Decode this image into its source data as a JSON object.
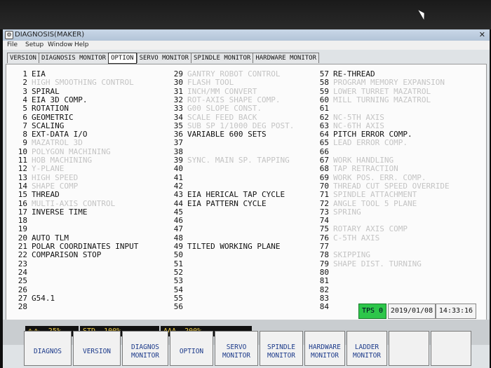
{
  "window": {
    "title": "DIAGNOSIS(MAKER)",
    "close": "✕"
  },
  "menu": [
    "File",
    "Setup",
    "Window",
    "Help"
  ],
  "tabs": [
    {
      "label": "VERSION",
      "active": false
    },
    {
      "label": "DIAGNOSIS MONITOR",
      "active": false
    },
    {
      "label": "OPTION",
      "active": true
    },
    {
      "label": "SERVO MONITOR",
      "active": false
    },
    {
      "label": "SPINDLE MONITOR",
      "active": false
    },
    {
      "label": "HARDWARE MONITOR",
      "active": false
    }
  ],
  "options": {
    "col1": [
      {
        "n": "1",
        "label": "EIA",
        "on": true
      },
      {
        "n": "2",
        "label": "HIGH SMOOTHING CONTROL",
        "on": false
      },
      {
        "n": "3",
        "label": "SPIRAL",
        "on": true
      },
      {
        "n": "4",
        "label": "EIA 3D COMP.",
        "on": true
      },
      {
        "n": "5",
        "label": "ROTATION",
        "on": true
      },
      {
        "n": "6",
        "label": "GEOMETRIC",
        "on": true
      },
      {
        "n": "7",
        "label": "SCALING",
        "on": true
      },
      {
        "n": "8",
        "label": "EXT-DATA I/O",
        "on": true
      },
      {
        "n": "9",
        "label": "MAZATROL 3D",
        "on": false
      },
      {
        "n": "10",
        "label": "POLYGON MACHINING",
        "on": false
      },
      {
        "n": "11",
        "label": "HOB MACHINING",
        "on": false
      },
      {
        "n": "12",
        "label": "Y-PLANE",
        "on": false
      },
      {
        "n": "13",
        "label": "HIGH SPEED",
        "on": false
      },
      {
        "n": "14",
        "label": "SHAPE COMP",
        "on": false
      },
      {
        "n": "15",
        "label": "THREAD",
        "on": true
      },
      {
        "n": "16",
        "label": "MULTI-AXIS CONTROL",
        "on": false
      },
      {
        "n": "17",
        "label": "INVERSE TIME",
        "on": true
      },
      {
        "n": "18",
        "label": "",
        "on": false
      },
      {
        "n": "19",
        "label": "",
        "on": false
      },
      {
        "n": "20",
        "label": "AUTO TLM",
        "on": true
      },
      {
        "n": "21",
        "label": "POLAR COORDINATES INPUT",
        "on": true
      },
      {
        "n": "22",
        "label": "COMPARISON STOP",
        "on": true
      },
      {
        "n": "23",
        "label": "",
        "on": false
      },
      {
        "n": "24",
        "label": "",
        "on": false
      },
      {
        "n": "25",
        "label": "",
        "on": false
      },
      {
        "n": "26",
        "label": "",
        "on": false
      },
      {
        "n": "27",
        "label": "G54.1",
        "on": true
      },
      {
        "n": "28",
        "label": "",
        "on": false
      }
    ],
    "col2": [
      {
        "n": "29",
        "label": "GANTRY ROBOT CONTROL",
        "on": false
      },
      {
        "n": "30",
        "label": "FLASH TOOL",
        "on": false
      },
      {
        "n": "31",
        "label": "INCH/MM CONVERT",
        "on": false
      },
      {
        "n": "32",
        "label": "ROT-AXIS SHAPE COMP.",
        "on": false
      },
      {
        "n": "33",
        "label": "G00 SLOPE CONST.",
        "on": false
      },
      {
        "n": "34",
        "label": "SCALE FEED BACK",
        "on": false
      },
      {
        "n": "35",
        "label": "SUB SP 1/1000 DEG POST.",
        "on": false
      },
      {
        "n": "36",
        "label": "VARIABLE 600 SETS",
        "on": true
      },
      {
        "n": "37",
        "label": "",
        "on": false
      },
      {
        "n": "38",
        "label": "",
        "on": false
      },
      {
        "n": "39",
        "label": "SYNC. MAIN SP. TAPPING",
        "on": false
      },
      {
        "n": "40",
        "label": "",
        "on": false
      },
      {
        "n": "41",
        "label": "",
        "on": false
      },
      {
        "n": "42",
        "label": "",
        "on": false
      },
      {
        "n": "43",
        "label": "EIA HERICAL TAP CYCLE",
        "on": true
      },
      {
        "n": "44",
        "label": "EIA PATTERN CYCLE",
        "on": true
      },
      {
        "n": "45",
        "label": "",
        "on": false
      },
      {
        "n": "46",
        "label": "",
        "on": false
      },
      {
        "n": "47",
        "label": "",
        "on": false
      },
      {
        "n": "48",
        "label": "",
        "on": false
      },
      {
        "n": "49",
        "label": "TILTED WORKING PLANE",
        "on": true
      },
      {
        "n": "50",
        "label": "",
        "on": false
      },
      {
        "n": "51",
        "label": "",
        "on": false
      },
      {
        "n": "52",
        "label": "",
        "on": false
      },
      {
        "n": "53",
        "label": "",
        "on": false
      },
      {
        "n": "54",
        "label": "",
        "on": false
      },
      {
        "n": "55",
        "label": "",
        "on": false
      },
      {
        "n": "56",
        "label": "",
        "on": false
      }
    ],
    "col3": [
      {
        "n": "57",
        "label": "RE-THREAD",
        "on": true
      },
      {
        "n": "58",
        "label": "PROGRAM MEMORY EXPANSION",
        "on": false
      },
      {
        "n": "59",
        "label": "LOWER TURRET MAZATROL",
        "on": false
      },
      {
        "n": "60",
        "label": "MILL TURNING MAZATROL",
        "on": false
      },
      {
        "n": "61",
        "label": "",
        "on": false
      },
      {
        "n": "62",
        "label": "NC-5TH AXIS",
        "on": false
      },
      {
        "n": "63",
        "label": "NC-6TH AXIS",
        "on": false
      },
      {
        "n": "64",
        "label": "PITCH ERROR COMP.",
        "on": true
      },
      {
        "n": "65",
        "label": "LEAD ERROR COMP.",
        "on": false
      },
      {
        "n": "66",
        "label": "",
        "on": false
      },
      {
        "n": "67",
        "label": "WORK HANDLING",
        "on": false
      },
      {
        "n": "68",
        "label": "TAP RETRACTION",
        "on": false
      },
      {
        "n": "69",
        "label": "WORK POS. ERR. COMP.",
        "on": false
      },
      {
        "n": "70",
        "label": "THREAD CUT SPEED OVERRIDE",
        "on": false
      },
      {
        "n": "71",
        "label": "SPINDLE ATTACHMENT",
        "on": false
      },
      {
        "n": "72",
        "label": "ANGLE TOOL 5 PLANE",
        "on": false
      },
      {
        "n": "73",
        "label": "SPRING",
        "on": false
      },
      {
        "n": "74",
        "label": "",
        "on": false
      },
      {
        "n": "75",
        "label": "ROTARY AXIS COMP",
        "on": false
      },
      {
        "n": "76",
        "label": "C-5TH AXIS",
        "on": false
      },
      {
        "n": "77",
        "label": "",
        "on": false
      },
      {
        "n": "78",
        "label": "SKIPPING",
        "on": false
      },
      {
        "n": "79",
        "label": "SHAPE DIST. TURNING",
        "on": false
      },
      {
        "n": "80",
        "label": "",
        "on": false
      },
      {
        "n": "81",
        "label": "",
        "on": false
      },
      {
        "n": "82",
        "label": "",
        "on": false
      },
      {
        "n": "83",
        "label": "",
        "on": false
      },
      {
        "n": "84",
        "label": "",
        "on": false
      }
    ]
  },
  "status": {
    "tps": "TPS 0",
    "date": "2019/01/08",
    "time": "14:33:16",
    "tps_color": "#2dc64a"
  },
  "meters": [
    {
      "icon": "∿∿",
      "value": "25%"
    },
    {
      "icon": "STD",
      "value": "100%"
    },
    {
      "icon": "ΛΛΛ",
      "value": "200%"
    }
  ],
  "fkeys": [
    {
      "label": "DIAGNOS"
    },
    {
      "label": "VERSION"
    },
    {
      "label": "DIAGNOS MONITOR"
    },
    {
      "label": "OPTION"
    },
    {
      "label": "SERVO MONITOR"
    },
    {
      "label": "SPINDLE MONITOR"
    },
    {
      "label": "HARDWARE MONITOR"
    },
    {
      "label": "LADDER MONITOR"
    },
    {
      "label": ""
    },
    {
      "label": ""
    }
  ]
}
